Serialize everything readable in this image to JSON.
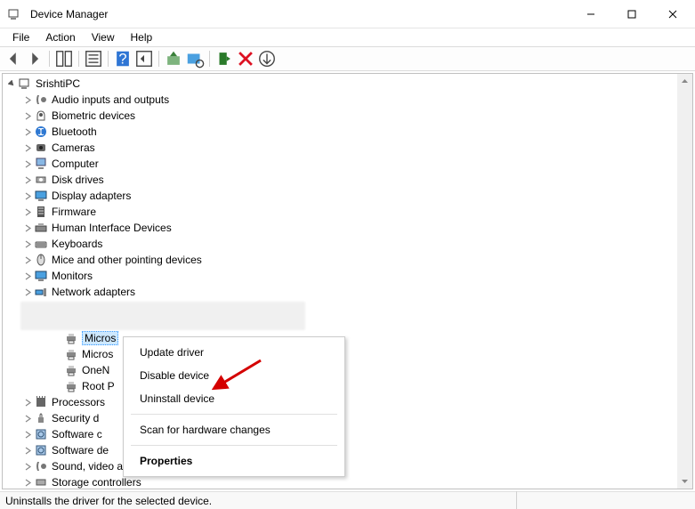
{
  "title": "Device Manager",
  "menu": {
    "file": "File",
    "action": "Action",
    "view": "View",
    "help": "Help"
  },
  "root": "SrishtiPC",
  "categories": [
    "Audio inputs and outputs",
    "Biometric devices",
    "Bluetooth",
    "Cameras",
    "Computer",
    "Disk drives",
    "Display adapters",
    "Firmware",
    "Human Interface Devices",
    "Keyboards",
    "Mice and other pointing devices",
    "Monitors",
    "Network adapters"
  ],
  "children_partial": [
    "Micros",
    "Micros",
    "OneN",
    "Root P"
  ],
  "categories_after": [
    "Processors",
    "Security d",
    "Software c",
    "Software de",
    "Sound, video and game controllers",
    "Storage controllers"
  ],
  "context_menu": {
    "update": "Update driver",
    "disable": "Disable device",
    "uninstall": "Uninstall device",
    "scan": "Scan for hardware changes",
    "properties": "Properties"
  },
  "statusbar": "Uninstalls the driver for the selected device."
}
